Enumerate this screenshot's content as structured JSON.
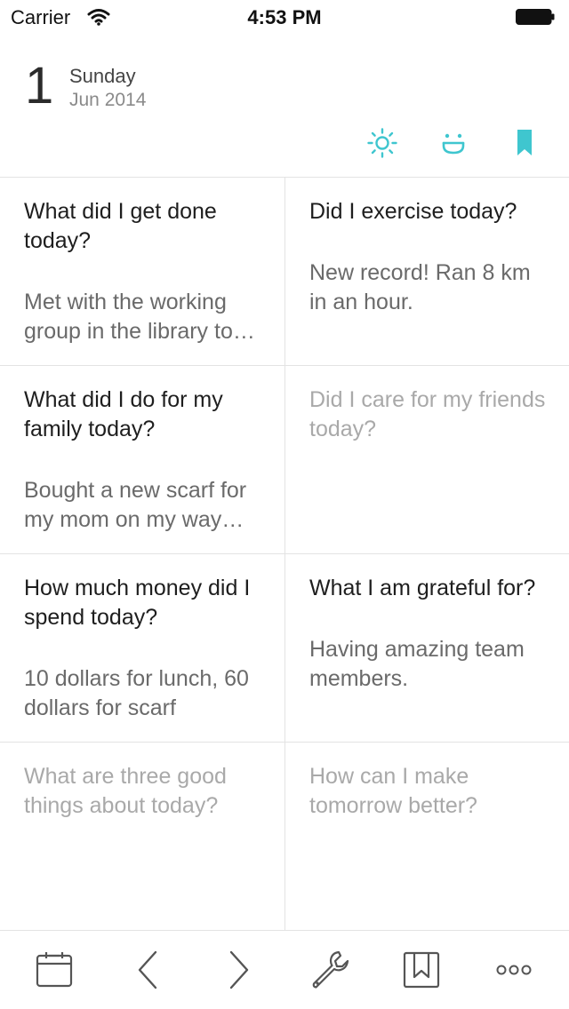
{
  "status_bar": {
    "carrier": "Carrier",
    "time": "4:53 PM"
  },
  "date": {
    "day_number": "1",
    "day_name": "Sunday",
    "month_year": "Jun 2014"
  },
  "header_icons": [
    "weather-sun-icon",
    "mood-smiley-icon",
    "bookmark-icon"
  ],
  "accent_color": "#3fc6cf",
  "cells": [
    {
      "question": "What did I get done today?",
      "answer": "Met with the working group in the library to finalize the plan",
      "answered": true
    },
    {
      "question": "Did I exercise today?",
      "answer": "New record! Ran 8 km in an hour.",
      "answered": true
    },
    {
      "question": "What did I do for my family today?",
      "answer": "Bought a new scarf for my mom on my way home",
      "answered": true
    },
    {
      "question": "Did I care for my friends today?",
      "answer": "",
      "answered": false
    },
    {
      "question": "How much money did I spend today?",
      "answer": "10 dollars for lunch, 60 dollars for scarf",
      "answered": true
    },
    {
      "question": "What I am grateful for?",
      "answer": "Having amazing team members.",
      "answered": true
    },
    {
      "question": "What are three good things about today?",
      "answer": "",
      "answered": false
    },
    {
      "question": "How can I make tomorrow better?",
      "answer": "",
      "answered": false
    }
  ],
  "toolbar": [
    "calendar-icon",
    "back-chevron-icon",
    "forward-chevron-icon",
    "settings-wrench-icon",
    "bookmarks-icon",
    "more-icon"
  ]
}
